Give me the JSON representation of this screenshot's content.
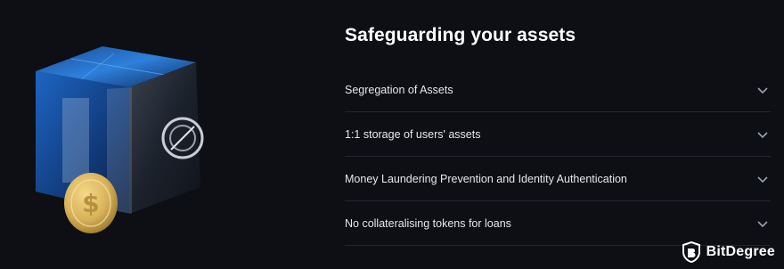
{
  "section": {
    "title": "Safeguarding your assets"
  },
  "faq": {
    "items": [
      {
        "label": "Segregation of Assets",
        "icon": "chevron-down-icon"
      },
      {
        "label": "1:1 storage of users' assets",
        "icon": "chevron-down-icon"
      },
      {
        "label": "Money Laundering Prevention and Identity Authentication",
        "icon": "chevron-down-icon"
      },
      {
        "label": "No collateralising tokens for loans",
        "icon": "chevron-down-icon"
      }
    ]
  },
  "brand": {
    "name": "BitDegree",
    "icon": "bitdegree-shield-logo"
  },
  "colors": {
    "background": "#0d0f14",
    "divider": "#23262d",
    "cube_blue": "#1f6fd6",
    "coin_gold": "#d9b25a"
  }
}
